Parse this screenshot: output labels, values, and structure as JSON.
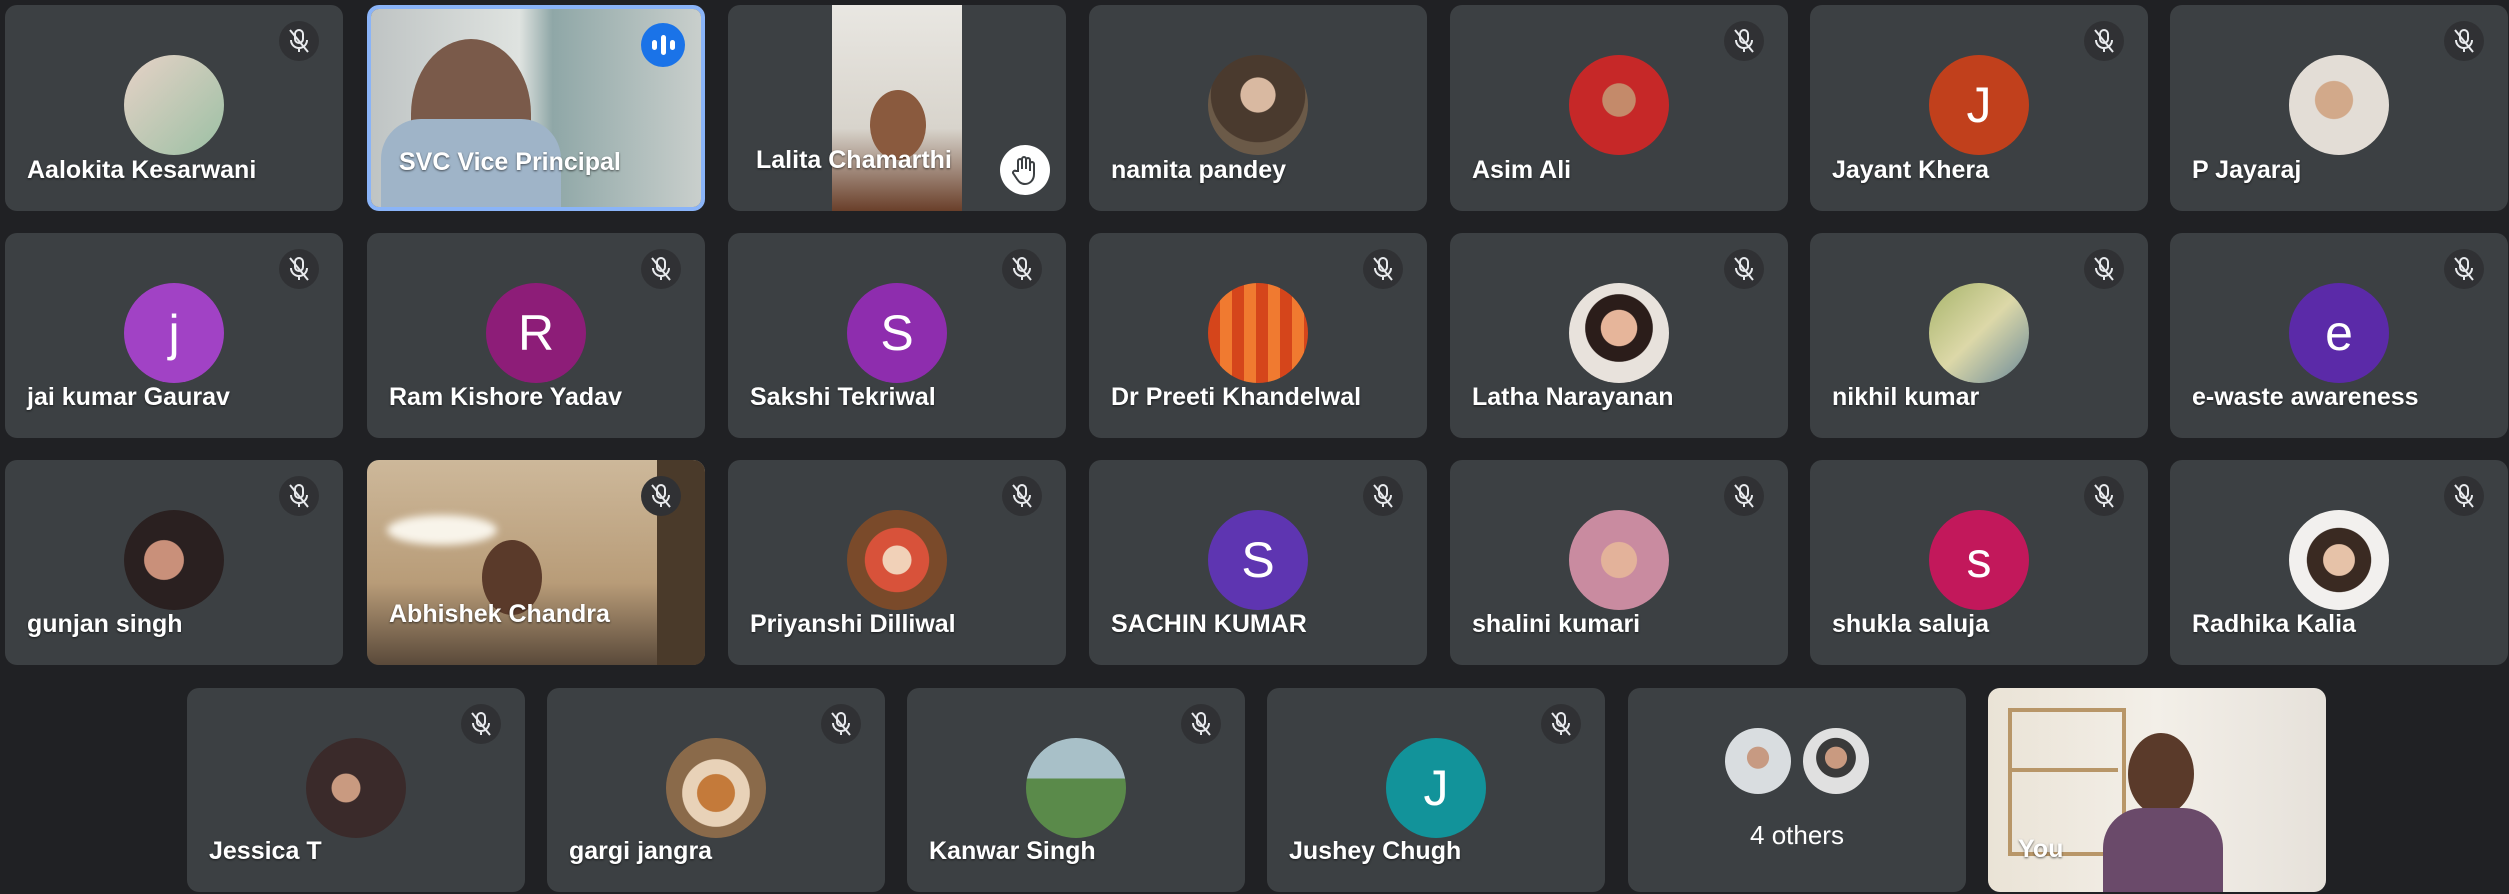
{
  "participants": [
    {
      "name": "Aalokita Kesarwani",
      "type": "photo"
    },
    {
      "name": "SVC Vice Principal",
      "type": "video"
    },
    {
      "name": "Lalita Chamarthi",
      "type": "video"
    },
    {
      "name": "namita pandey",
      "type": "photo"
    },
    {
      "name": "Asim Ali",
      "type": "photo"
    },
    {
      "name": "Jayant Khera",
      "type": "initial",
      "initial": "J",
      "color": "#c1401c"
    },
    {
      "name": "P Jayaraj",
      "type": "photo"
    },
    {
      "name": "jai kumar Gaurav",
      "type": "initial",
      "initial": "j",
      "color": "#a142c5"
    },
    {
      "name": "Ram Kishore Yadav",
      "type": "initial",
      "initial": "R",
      "color": "#8d1d78"
    },
    {
      "name": "Sakshi Tekriwal",
      "type": "initial",
      "initial": "S",
      "color": "#8e2dae"
    },
    {
      "name": "Dr Preeti Khandelwal",
      "type": "photo"
    },
    {
      "name": "Latha Narayanan",
      "type": "photo"
    },
    {
      "name": "nikhil kumar",
      "type": "photo"
    },
    {
      "name": "e-waste awareness",
      "type": "initial",
      "initial": "e",
      "color": "#5b2aa8"
    },
    {
      "name": "gunjan singh",
      "type": "photo"
    },
    {
      "name": "Abhishek Chandra",
      "type": "video"
    },
    {
      "name": "Priyanshi Dilliwal",
      "type": "photo"
    },
    {
      "name": "SACHIN KUMAR",
      "type": "initial",
      "initial": "S",
      "color": "#5e35b1"
    },
    {
      "name": "shalini kumari",
      "type": "photo"
    },
    {
      "name": "shukla saluja",
      "type": "initial",
      "initial": "s",
      "color": "#c2185b"
    },
    {
      "name": "Radhika Kalia",
      "type": "photo"
    },
    {
      "name": "Jessica T",
      "type": "photo"
    },
    {
      "name": "gargi jangra",
      "type": "photo"
    },
    {
      "name": "Kanwar Singh",
      "type": "photo"
    },
    {
      "name": "Jushey Chugh",
      "type": "initial",
      "initial": "J",
      "color": "#12939a"
    },
    {
      "name": "4 others",
      "type": "others"
    },
    {
      "name": "You",
      "type": "video"
    }
  ],
  "colors": {
    "background": "#202124",
    "tile": "#3c4043",
    "active_border": "#8ab4f8",
    "speaking": "#1a73e8"
  },
  "icons": {
    "muted": "mic-off-icon",
    "speaking": "speaking-indicator-icon",
    "raised_hand": "raised-hand-icon"
  }
}
